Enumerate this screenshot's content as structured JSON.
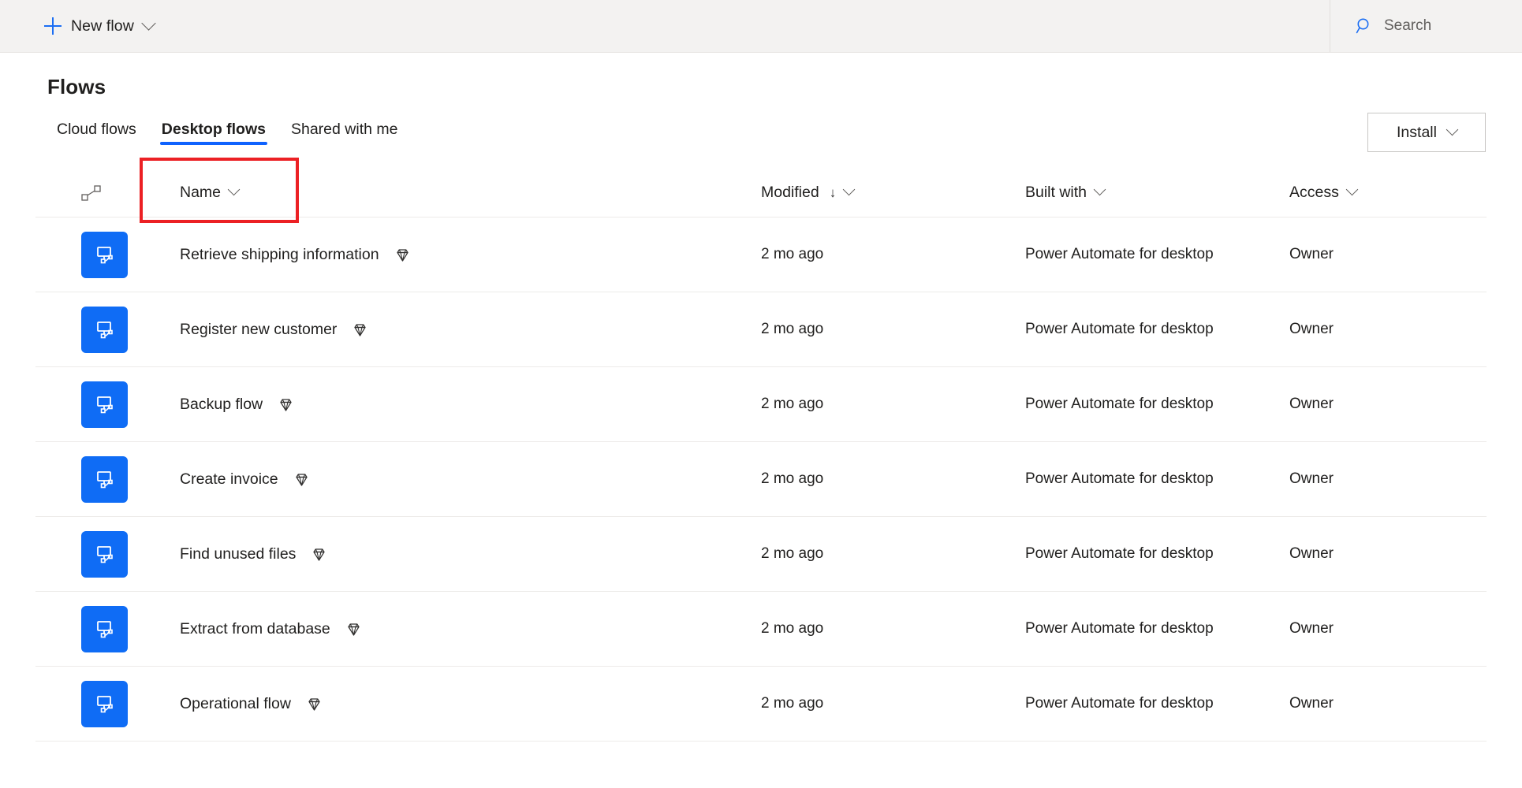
{
  "toolbar": {
    "new_flow_label": "New flow",
    "new_flow_icon": "plus-icon",
    "new_flow_chevron": "chevron-down-icon",
    "search_placeholder": "Search",
    "search_icon": "search-icon"
  },
  "page": {
    "title": "Flows",
    "install_label": "Install",
    "install_chevron": "chevron-down-icon"
  },
  "tabs": [
    {
      "label": "Cloud flows",
      "active": false
    },
    {
      "label": "Desktop flows",
      "active": true
    },
    {
      "label": "Shared with me",
      "active": false
    }
  ],
  "annotation": {
    "type": "red-rectangle-highlight",
    "target": "Desktop flows",
    "color": "#ec2024"
  },
  "table": {
    "columns": [
      {
        "key": "icon",
        "label": "",
        "icon": "flow-connector-icon",
        "chevron": false,
        "sorted": false
      },
      {
        "key": "name",
        "label": "Name",
        "chevron": true,
        "sorted": false
      },
      {
        "key": "modified",
        "label": "Modified",
        "chevron": true,
        "sorted": true,
        "sort_direction": "↓"
      },
      {
        "key": "built_with",
        "label": "Built with",
        "chevron": true,
        "sorted": false
      },
      {
        "key": "access",
        "label": "Access",
        "chevron": true,
        "sorted": false
      }
    ],
    "rows": [
      {
        "icon": "desktop-flow-icon",
        "name": "Retrieve shipping information",
        "badge": "premium-diamond-icon",
        "modified": "2 mo ago",
        "built_with": "Power Automate for desktop",
        "access": "Owner"
      },
      {
        "icon": "desktop-flow-icon",
        "name": "Register new customer",
        "badge": "premium-diamond-icon",
        "modified": "2 mo ago",
        "built_with": "Power Automate for desktop",
        "access": "Owner"
      },
      {
        "icon": "desktop-flow-icon",
        "name": "Backup flow",
        "badge": "premium-diamond-icon",
        "modified": "2 mo ago",
        "built_with": "Power Automate for desktop",
        "access": "Owner"
      },
      {
        "icon": "desktop-flow-icon",
        "name": "Create invoice",
        "badge": "premium-diamond-icon",
        "modified": "2 mo ago",
        "built_with": "Power Automate for desktop",
        "access": "Owner"
      },
      {
        "icon": "desktop-flow-icon",
        "name": "Find unused files",
        "badge": "premium-diamond-icon",
        "modified": "2 mo ago",
        "built_with": "Power Automate for desktop",
        "access": "Owner"
      },
      {
        "icon": "desktop-flow-icon",
        "name": "Extract from database",
        "badge": "premium-diamond-icon",
        "modified": "2 mo ago",
        "built_with": "Power Automate for desktop",
        "access": "Owner"
      },
      {
        "icon": "desktop-flow-icon",
        "name": "Operational flow",
        "badge": "premium-diamond-icon",
        "modified": "2 mo ago",
        "built_with": "Power Automate for desktop",
        "access": "Owner"
      }
    ]
  },
  "colors": {
    "accent_blue": "#0f62fe",
    "tile_blue": "#0f6cf5",
    "plus_blue": "#1b6ef3",
    "annotation_red": "#ec2024",
    "toolbar_bg": "#f3f2f1",
    "divider": "#edebe9",
    "text": "#201f1e",
    "muted_text": "#605e5c"
  }
}
